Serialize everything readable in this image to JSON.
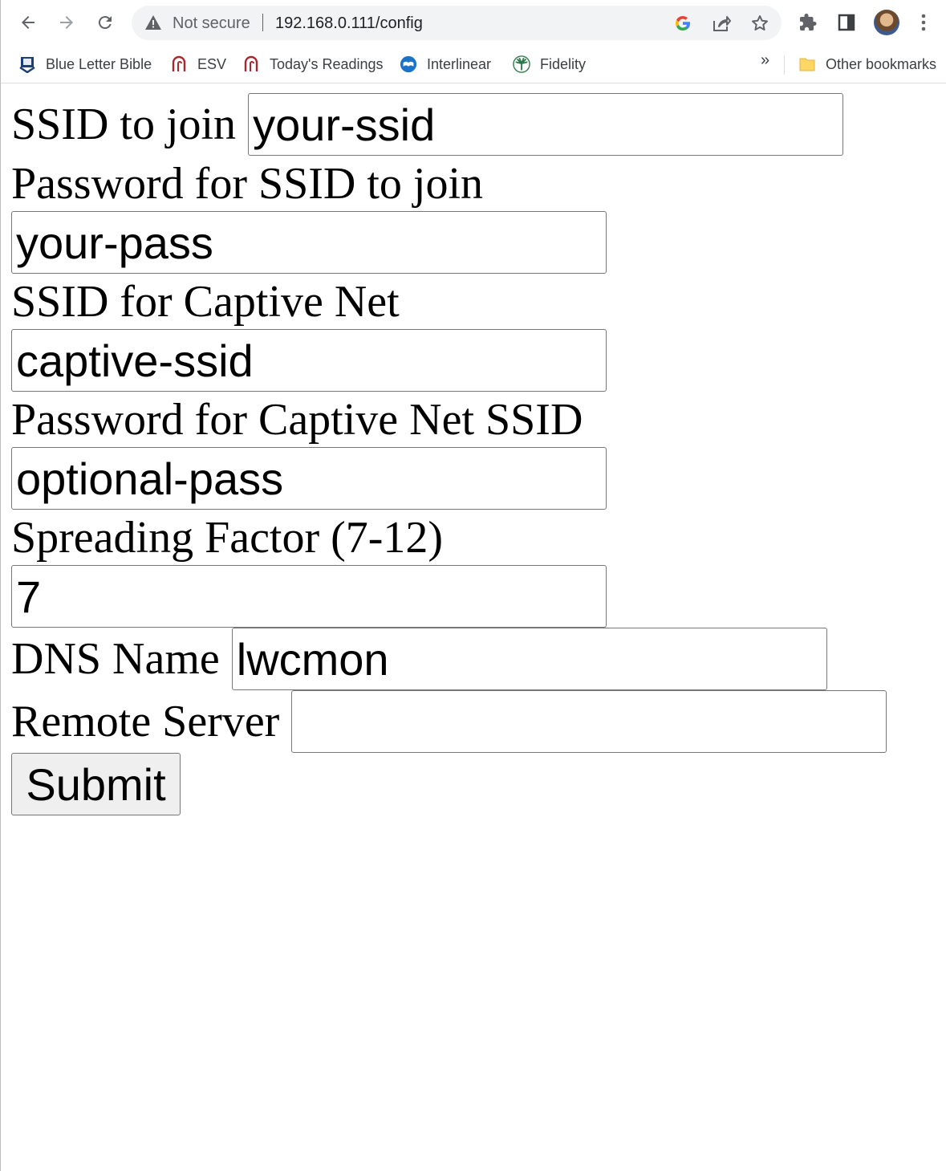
{
  "browser": {
    "security_label": "Not secure",
    "url": "192.168.0.111/config",
    "icons": [
      "back-icon",
      "forward-icon",
      "reload-icon",
      "warning-icon",
      "google-icon",
      "share-icon",
      "star-icon",
      "extensions-icon",
      "side-panel-icon",
      "avatar",
      "menu-icon"
    ]
  },
  "bookmarks": {
    "items": [
      {
        "label": "Blue Letter Bible",
        "icon": "blue-letter-bible-icon"
      },
      {
        "label": "ESV",
        "icon": "esv-icon"
      },
      {
        "label": "Today's Readings",
        "icon": "esv-icon"
      },
      {
        "label": "Interlinear",
        "icon": "interlinear-icon"
      },
      {
        "label": "Fidelity",
        "icon": "fidelity-icon"
      }
    ],
    "overflow": "»",
    "other": "Other bookmarks"
  },
  "form": {
    "ssid_label": "SSID to join",
    "ssid_value": "your-ssid",
    "password_label": "Password for SSID to join",
    "password_value": "your-pass",
    "captive_ssid_label": "SSID for Captive Net",
    "captive_ssid_value": "captive-ssid",
    "captive_password_label": "Password for Captive Net SSID",
    "captive_password_value": "optional-pass",
    "sf_label": "Spreading Factor (7-12)",
    "sf_value": "7",
    "dns_label": "DNS Name",
    "dns_value": "lwcmon",
    "remote_label": "Remote Server",
    "remote_value": "",
    "submit_label": "Submit"
  }
}
